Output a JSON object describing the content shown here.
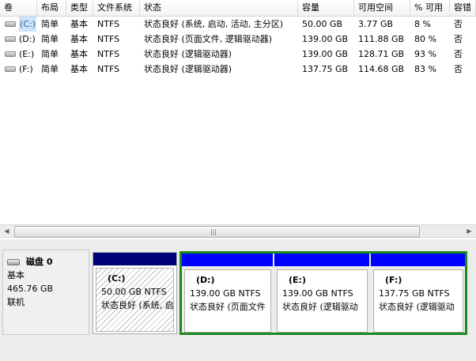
{
  "table": {
    "columns": [
      "卷",
      "布局",
      "类型",
      "文件系统",
      "状态",
      "容量",
      "可用空间",
      "% 可用",
      "容错"
    ],
    "rows": [
      {
        "volume": "(C:)",
        "layout": "简单",
        "type": "基本",
        "fs": "NTFS",
        "status": "状态良好 (系统, 启动, 活动, 主分区)",
        "capacity": "50.00 GB",
        "free": "3.77 GB",
        "pct": "8 %",
        "ft": "否",
        "selected": true
      },
      {
        "volume": "(D:)",
        "layout": "简单",
        "type": "基本",
        "fs": "NTFS",
        "status": "状态良好 (页面文件, 逻辑驱动器)",
        "capacity": "139.00 GB",
        "free": "111.88 GB",
        "pct": "80 %",
        "ft": "否",
        "selected": false
      },
      {
        "volume": "(E:)",
        "layout": "简单",
        "type": "基本",
        "fs": "NTFS",
        "status": "状态良好 (逻辑驱动器)",
        "capacity": "139.00 GB",
        "free": "128.71 GB",
        "pct": "93 %",
        "ft": "否",
        "selected": false
      },
      {
        "volume": "(F:)",
        "layout": "简单",
        "type": "基本",
        "fs": "NTFS",
        "status": "状态良好 (逻辑驱动器)",
        "capacity": "137.75 GB",
        "free": "114.68 GB",
        "pct": "83 %",
        "ft": "否",
        "selected": false
      }
    ]
  },
  "scrollbar": {
    "left": "◀",
    "right": "▶",
    "grip": "|||"
  },
  "disk": {
    "title": "磁盘 0",
    "type": "基本",
    "size": "465.76 GB",
    "status": "联机"
  },
  "partitions": {
    "c": {
      "label": "(C:)",
      "size": "50.00 GB NTFS",
      "status": "状态良好 (系统, 启"
    },
    "d": {
      "label": "(D:)",
      "size": "139.00 GB NTFS",
      "status": "状态良好 (页面文件"
    },
    "e": {
      "label": "(E:)",
      "size": "139.00 GB NTFS",
      "status": "状态良好 (逻辑驱动"
    },
    "f": {
      "label": "(F:)",
      "size": "137.75 GB NTFS",
      "status": "状态良好 (逻辑驱动"
    }
  },
  "colors": {
    "primary_bar": "#00007a",
    "logical_bar": "#0000ff",
    "extended_border": "#1a8a1a",
    "selection": "#cde3f7"
  }
}
